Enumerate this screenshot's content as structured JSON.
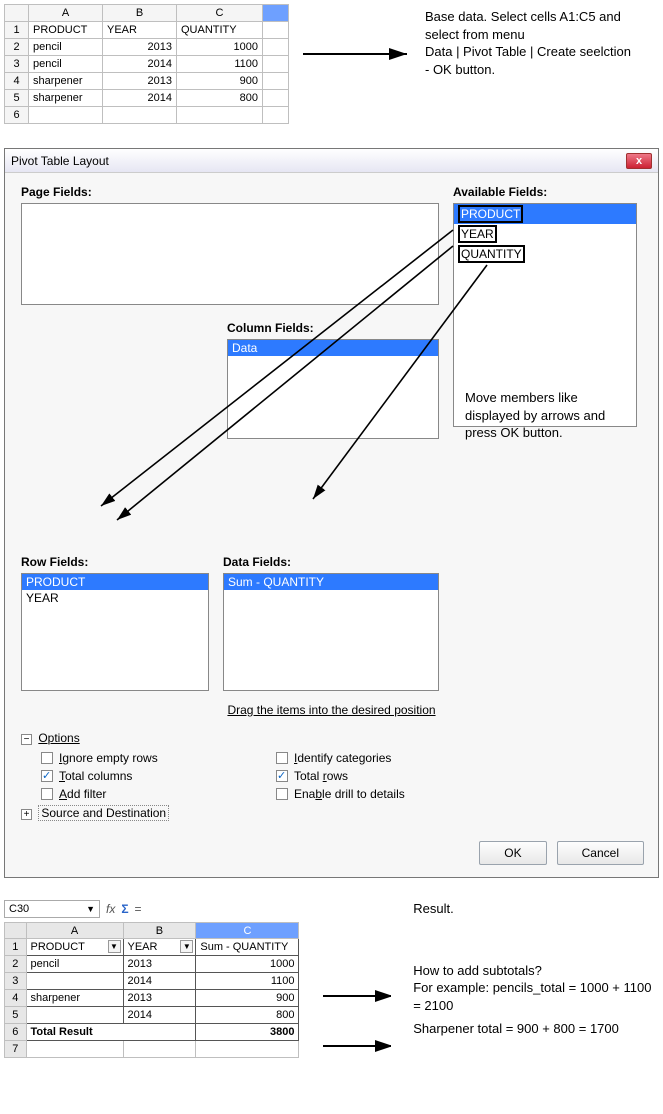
{
  "source_table": {
    "cols": [
      "A",
      "B",
      "C"
    ],
    "rows": [
      {
        "n": "1",
        "product": "PRODUCT",
        "year": "YEAR",
        "qty": "QUANTITY"
      },
      {
        "n": "2",
        "product": "pencil",
        "year": "2013",
        "qty": "1000"
      },
      {
        "n": "3",
        "product": "pencil",
        "year": "2014",
        "qty": "1100"
      },
      {
        "n": "4",
        "product": "sharpener",
        "year": "2013",
        "qty": "900"
      },
      {
        "n": "5",
        "product": "sharpener",
        "year": "2014",
        "qty": "800"
      },
      {
        "n": "6",
        "product": "",
        "year": "",
        "qty": ""
      }
    ]
  },
  "annot": {
    "top": "Base data. Select cells A1:C5 and select from menu\nData | Pivot Table | Create seelction -  OK button.",
    "move": "Move members like displayed by arrows and press OK button.",
    "result_label": "Result.",
    "subtotals": "How to add subtotals?\nFor example: pencils_total = 1000 + 1100 = 2100",
    "sharpener": "Sharpener total = 900 + 800 = 1700"
  },
  "dialog": {
    "title": "Pivot Table Layout",
    "close": "x",
    "page_label": "Page Fields:",
    "avail_label": "Available Fields:",
    "avail_items": [
      "PRODUCT",
      "YEAR",
      "QUANTITY"
    ],
    "col_label": "Column Fields:",
    "col_item": "Data",
    "row_label": "Row Fields:",
    "row_items": [
      "PRODUCT",
      "YEAR"
    ],
    "data_label": "Data Fields:",
    "data_item": "Sum - QUANTITY",
    "draghint": "Drag the items into the desired position",
    "options_label": "Options",
    "opts": {
      "ignore": "Ignore empty rows",
      "identify": "Identify categories",
      "totalcols": "Total columns",
      "totalrows": "Total rows",
      "addfilter": "Add filter",
      "drill": "Enable drill to details"
    },
    "src_dest": "Source and Destination",
    "ok": "OK",
    "cancel": "Cancel"
  },
  "result": {
    "cellref": "C30",
    "fx_prefix": "fx",
    "sigma": "Σ",
    "equals": "=",
    "cols": [
      "A",
      "B",
      "C"
    ],
    "header": {
      "product": "PRODUCT",
      "year": "YEAR",
      "sum": "Sum - QUANTITY"
    },
    "rows": [
      {
        "n": "2",
        "product": "pencil",
        "year": "2013",
        "qty": "1000"
      },
      {
        "n": "3",
        "product": "",
        "year": "2014",
        "qty": "1100"
      },
      {
        "n": "4",
        "product": "sharpener",
        "year": "2013",
        "qty": "900"
      },
      {
        "n": "5",
        "product": "",
        "year": "2014",
        "qty": "800"
      }
    ],
    "total": {
      "n": "6",
      "label": "Total Result",
      "qty": "3800"
    }
  }
}
